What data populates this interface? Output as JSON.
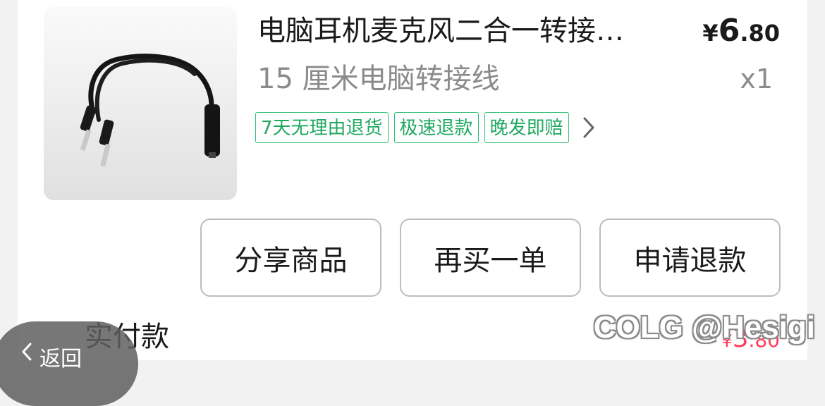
{
  "product": {
    "image": {
      "icon": "audio-splitter-cable-image"
    },
    "title": "电脑耳机麦克风二合一转接…",
    "price": {
      "currency": "¥",
      "integer": "6",
      "decimal": ".80"
    },
    "spec": "15 厘米电脑转接线",
    "quantity": "x1",
    "tags": [
      {
        "label": "7天无理由退货"
      },
      {
        "label": "极速退款"
      },
      {
        "label": "晚发即赔"
      }
    ]
  },
  "actions": {
    "share_label": "分享商品",
    "rebuy_label": "再买一单",
    "refund_label": "申请退款"
  },
  "summary": {
    "label": "实付款",
    "currency": "¥",
    "integer": "3",
    "decimal": ".80"
  },
  "back": {
    "label": "返回"
  },
  "watermark": {
    "text": "COLG @Hesigi"
  },
  "colors": {
    "tag_green": "#1fa860",
    "price_red": "#ff3b5c",
    "button_border": "#bdbdbd"
  }
}
